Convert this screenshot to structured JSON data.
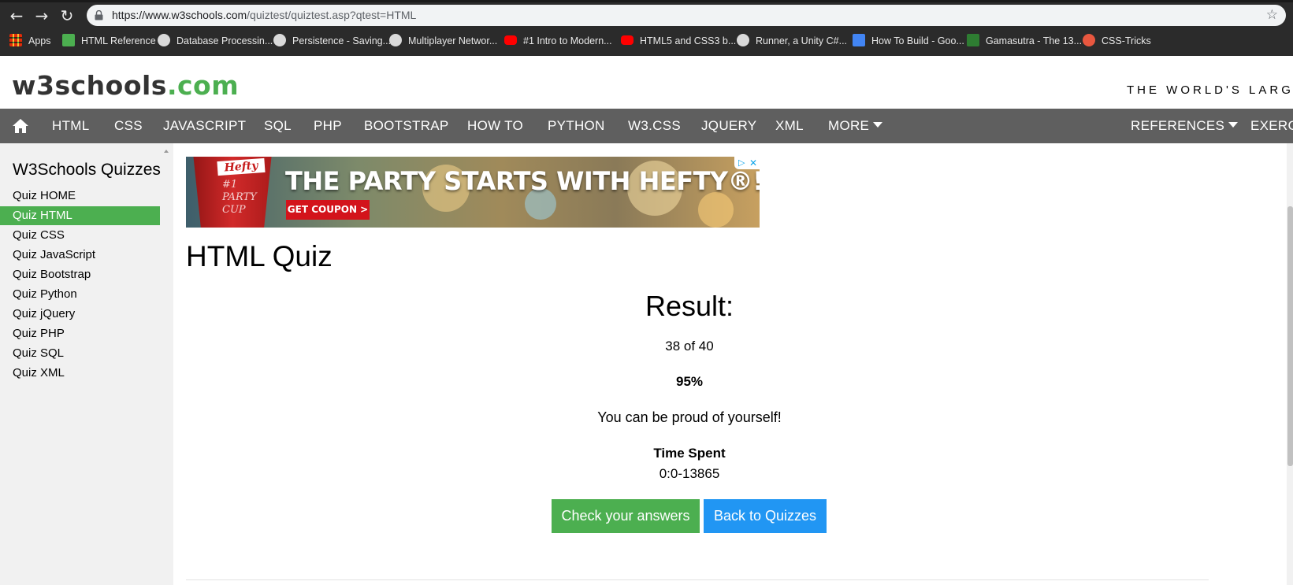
{
  "browser": {
    "back_icon": "arrow-left-icon",
    "forward_icon": "arrow-right-icon",
    "reload_icon": "reload-icon",
    "url_host": "https://www.w3schools.com",
    "url_path": "/quiztest/quiztest.asp?qtest=HTML",
    "bookmark_star_icon": "star-icon",
    "bookmarks": [
      {
        "label": "Apps",
        "icon": "apps-grid-icon",
        "color": "#e53935"
      },
      {
        "label": "HTML Reference",
        "icon": "w3-icon",
        "color": "#4CAF50"
      },
      {
        "label": "Database Processin...",
        "icon": "db-icon",
        "color": "#d9d9d9"
      },
      {
        "label": "Persistence - Saving...",
        "icon": "globe-icon",
        "color": "#d9d9d9"
      },
      {
        "label": "Multiplayer Networ...",
        "icon": "unity-icon",
        "color": "#d9d9d9"
      },
      {
        "label": "#1 Intro to Modern...",
        "icon": "youtube-icon",
        "color": "#ff0000"
      },
      {
        "label": "HTML5 and CSS3 b...",
        "icon": "youtube-icon",
        "color": "#ff0000"
      },
      {
        "label": "Runner, a Unity C#...",
        "icon": "paw-icon",
        "color": "#d9d9d9"
      },
      {
        "label": "How To Build - Goo...",
        "icon": "docs-icon",
        "color": "#4285f4"
      },
      {
        "label": "Gamasutra - The 13...",
        "icon": "gamasutra-icon",
        "color": "#2e7d32"
      },
      {
        "label": "CSS-Tricks",
        "icon": "css-tricks-icon",
        "color": "#e8573f"
      }
    ]
  },
  "header": {
    "logo_main": "w3schools",
    "logo_tld": ".com",
    "tagline": "THE WORLD'S LARGES"
  },
  "topnav": {
    "home_icon": "home-icon",
    "items": [
      "HTML",
      "CSS",
      "JAVASCRIPT",
      "SQL",
      "PHP",
      "BOOTSTRAP",
      "HOW TO",
      "PYTHON",
      "W3.CSS",
      "JQUERY",
      "XML",
      "MORE"
    ],
    "references": "REFERENCES",
    "exercises": "EXERCI"
  },
  "sidebar": {
    "title": "W3Schools Quizzes",
    "items": [
      {
        "label": "Quiz HOME",
        "active": false
      },
      {
        "label": "Quiz HTML",
        "active": true
      },
      {
        "label": "Quiz CSS",
        "active": false
      },
      {
        "label": "Quiz JavaScript",
        "active": false
      },
      {
        "label": "Quiz Bootstrap",
        "active": false
      },
      {
        "label": "Quiz Python",
        "active": false
      },
      {
        "label": "Quiz jQuery",
        "active": false
      },
      {
        "label": "Quiz PHP",
        "active": false
      },
      {
        "label": "Quiz SQL",
        "active": false
      },
      {
        "label": "Quiz XML",
        "active": false
      }
    ]
  },
  "ad": {
    "brand": "Hefty",
    "cup_text": "#1 PARTY CUP",
    "headline": "THE PARTY STARTS WITH HEFTY®!",
    "cta": "GET COUPON >"
  },
  "main": {
    "title": "HTML Quiz",
    "result_heading": "Result:",
    "score": "38 of 40",
    "percent": "95%",
    "message": "You can be proud of yourself!",
    "time_label": "Time Spent",
    "time_value": "0:0-13865",
    "check_button": "Check your answers",
    "back_button": "Back to Quizzes"
  },
  "colors": {
    "accent_green": "#4CAF50",
    "accent_blue": "#2196F3",
    "nav_bg": "#5f5f5f",
    "sidebar_bg": "#f1f1f1"
  }
}
